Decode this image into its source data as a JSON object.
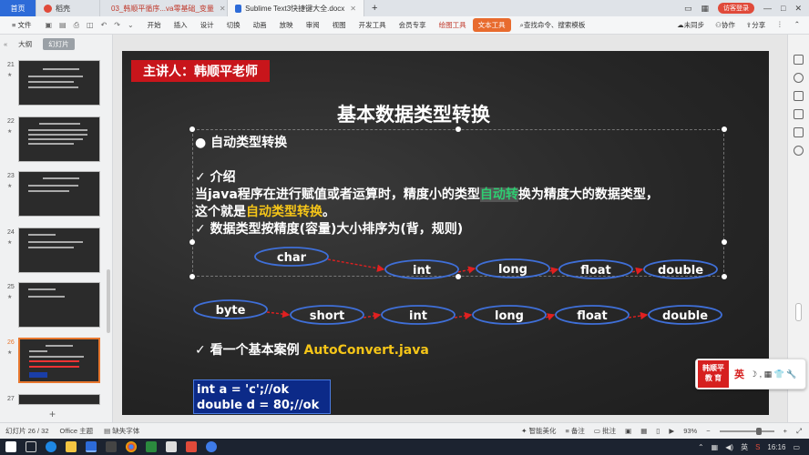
{
  "titlebar": {
    "tabs": [
      {
        "label": "首页",
        "icon": "home-tab"
      },
      {
        "label": "稻壳",
        "icon": "wps-logo-icon"
      },
      {
        "label": "03_韩顺平循序...va零基础_变量",
        "icon": "ppt-file-icon"
      },
      {
        "label": "Sublime Text3快捷键大全.docx",
        "icon": "word-file-icon"
      }
    ],
    "new_tab": "+",
    "visitor": "访客登录",
    "min": "—",
    "max": "□",
    "close": "✕"
  },
  "menubar": {
    "file": "≡ 文件",
    "items": [
      "开始",
      "插入",
      "设计",
      "切换",
      "动画",
      "放映",
      "审阅",
      "视图",
      "开发工具",
      "会员专享"
    ],
    "drawing_tool": "绘图工具",
    "text_tool": "文本工具",
    "search": "查找命令、搜索模板",
    "unsynced": "未同步",
    "collab": "协作",
    "share": "分享"
  },
  "sidebar": {
    "tab_outline": "大纲",
    "tab_slides": "幻灯片",
    "slides": [
      {
        "num": "21",
        "star": "★"
      },
      {
        "num": "22",
        "star": "★"
      },
      {
        "num": "23",
        "star": "★"
      },
      {
        "num": "24",
        "star": "★"
      },
      {
        "num": "25",
        "star": "★"
      },
      {
        "num": "26",
        "star": "★"
      },
      {
        "num": "27",
        "star": ""
      }
    ],
    "add": "+"
  },
  "slide": {
    "lecturer": "主讲人：韩顺平老师",
    "title": "基本数据类型转换",
    "bullet1": "● 自动类型转换",
    "intro": "✓ 介绍",
    "line1a": "当java程序在进行赋值或者运算时，精度小的类型",
    "line1b": "自动转",
    "line1c": "换为精度大的数据类型，",
    "line2a": "这个就是",
    "line2b": "自动类型转换",
    "line2c": "。",
    "sort_rule": "✓ 数据类型按精度(容量)大小排序为(背，规则)",
    "chain1": [
      "char",
      "int",
      "long",
      "float",
      "double"
    ],
    "chain2": [
      "byte",
      "short",
      "int",
      "long",
      "float",
      "double"
    ],
    "example_prefix": "✓ 看一个基本案例 ",
    "example_file": "AutoConvert.java",
    "code1": "int a = 'c';//ok",
    "code2": "double d = 80;//ok"
  },
  "logo": {
    "brand_line1": "韩顺平",
    "brand_line2": "教 育",
    "ime": "英",
    "icons": "☽ , ▦ 👕 🔧"
  },
  "statusbar": {
    "slide_counter": "幻灯片 26 / 32",
    "theme": "Office 主题",
    "missing_font": "缺失字体",
    "beautify": "智能美化",
    "notes": "备注",
    "comments": "批注",
    "zoom": "93%"
  },
  "taskbar": {
    "ime": "英",
    "time": "16:16"
  },
  "colors": {
    "lecturer_bg": "#c8151b",
    "highlight": "#f5c518",
    "arrow": "#e02020",
    "ellipse": "#3f6fd8",
    "code_bg": "#0c2a88"
  }
}
